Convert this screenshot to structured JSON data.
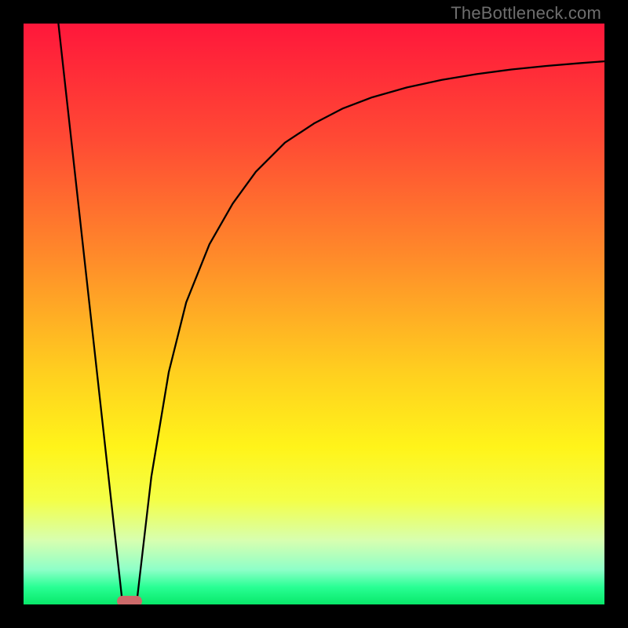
{
  "watermark": "TheBottleneck.com",
  "colors": {
    "gradient_stops": [
      {
        "pct": 0,
        "color": "#ff173b"
      },
      {
        "pct": 20,
        "color": "#ff4a34"
      },
      {
        "pct": 40,
        "color": "#ff8a2a"
      },
      {
        "pct": 60,
        "color": "#ffcf1f"
      },
      {
        "pct": 73,
        "color": "#fff41a"
      },
      {
        "pct": 82,
        "color": "#f4ff47"
      },
      {
        "pct": 89,
        "color": "#d7ffb0"
      },
      {
        "pct": 94,
        "color": "#8effc8"
      },
      {
        "pct": 97,
        "color": "#29ff94"
      },
      {
        "pct": 100,
        "color": "#08e869"
      }
    ],
    "marker": "#cc6a6a",
    "curve": "#000000",
    "frame": "#000000"
  },
  "chart_data": {
    "type": "line",
    "title": "",
    "xlabel": "",
    "ylabel": "",
    "xlim": [
      0,
      100
    ],
    "ylim": [
      0,
      100
    ],
    "grid": false,
    "series": [
      {
        "name": "left-segment",
        "x": [
          6,
          17
        ],
        "y": [
          100,
          0.5
        ]
      },
      {
        "name": "right-segment",
        "x": [
          19.5,
          22,
          25,
          28,
          32,
          36,
          40,
          45,
          50,
          55,
          60,
          66,
          72,
          78,
          84,
          90,
          96,
          100
        ],
        "y": [
          0.5,
          22,
          40,
          52,
          62,
          69,
          74.5,
          79.5,
          82.8,
          85.4,
          87.3,
          89.0,
          90.3,
          91.3,
          92.1,
          92.7,
          93.2,
          93.5
        ]
      }
    ],
    "annotations": [
      {
        "type": "marker",
        "shape": "pill",
        "x": 18.3,
        "y": 0.5
      }
    ]
  }
}
